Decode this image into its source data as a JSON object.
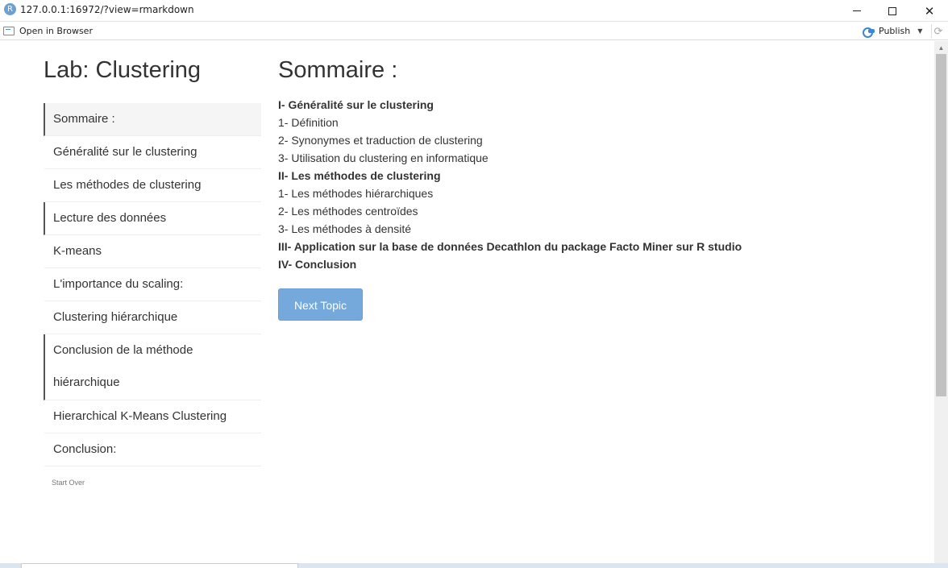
{
  "window": {
    "url": "127.0.0.1:16972/?view=rmarkdown",
    "logo_letter": "R"
  },
  "toolbar": {
    "open_in_browser": "Open in Browser",
    "publish": "Publish"
  },
  "sidebar": {
    "title": "Lab: Clustering",
    "items": [
      {
        "label": "Sommaire :"
      },
      {
        "label": "Généralité sur le clustering"
      },
      {
        "label": "Les méthodes de clustering"
      },
      {
        "label": "Lecture des données"
      },
      {
        "label": "K-means"
      },
      {
        "label": "L'importance du scaling:"
      },
      {
        "label": "Clustering hiérarchique"
      },
      {
        "label": "Conclusion de la méthode hiérarchique"
      },
      {
        "label": "Hierarchical K-Means Clustering"
      },
      {
        "label": "Conclusion:"
      }
    ],
    "start_over": "Start Over"
  },
  "main": {
    "title": "Sommaire :",
    "lines": [
      "I- Généralité sur le clustering",
      "1- Définition",
      "2- Synonymes et traduction de clustering",
      "3- Utilisation du clustering en informatique",
      "II- Les méthodes de clustering",
      "1- Les méthodes hiérarchiques",
      "2- Les méthodes centroïdes",
      "3- Les méthodes à densité",
      "III- Application sur la base de données Decathlon du package Facto Miner sur R studio",
      "IV- Conclusion"
    ],
    "next_button": "Next Topic"
  }
}
